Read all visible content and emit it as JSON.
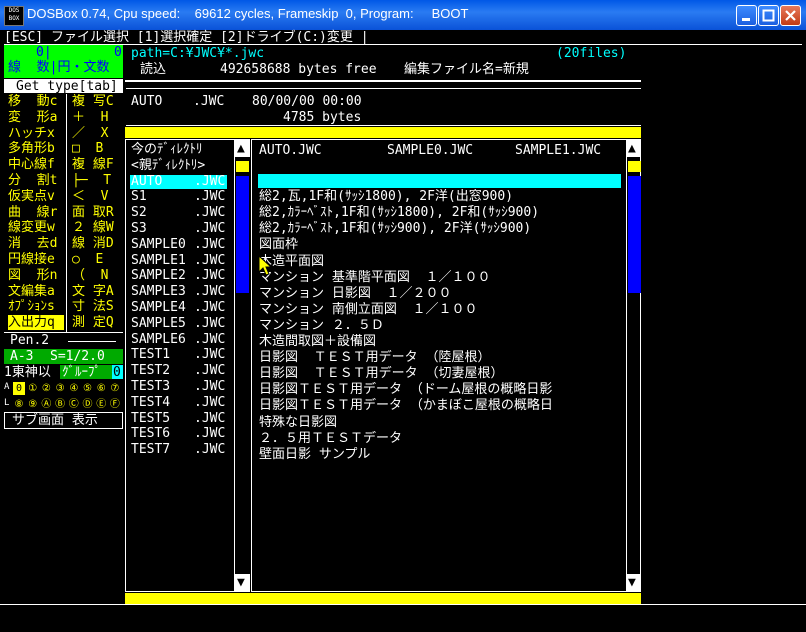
{
  "window": {
    "title": "DOSBox 0.74, Cpu speed:    69612 cycles, Frameskip  0, Program:     BOOT",
    "icon_text": [
      "DOS",
      "BOX"
    ]
  },
  "topbar": {
    "text": "[ESC] ファイル選択 [1]選択確定 [2]ドライブ(C:)変更 |"
  },
  "left_panel": {
    "header_nums": {
      "a": "0|",
      "b": "0"
    },
    "header_mode": "線  数|円・文数",
    "get_type": "Get type[tab]",
    "tools": [
      [
        "移  動c",
        "複 写C"
      ],
      [
        "変  形a",
        "＋  H"
      ],
      [
        "ハッチx",
        "／  X"
      ],
      [
        "多角形b",
        "□  B"
      ],
      [
        "中心線f",
        "複 線F"
      ],
      [
        "分  割t",
        "├─  T"
      ],
      [
        "仮実点v",
        "＜  V"
      ],
      [
        "曲  線r",
        "面 取R"
      ],
      [
        "線変更w",
        "２ 線W"
      ],
      [
        "消  去d",
        "線 消D"
      ],
      [
        "円線接e",
        "○  E"
      ],
      [
        "図  形n",
        "（  N"
      ],
      [
        "文編集a",
        "文 字A"
      ],
      [
        "ｵﾌﾟｼｮﾝs",
        "寸 法S"
      ],
      [
        "入出力q",
        "測 定Q"
      ]
    ],
    "pen": "Pen.2",
    "scale_a": "A-3",
    "scale_s": "S=1/2.0",
    "layer_label": "1東神以",
    "group_label": "ｸﾞﾙｰﾌﾟ",
    "group_val": "0",
    "row_a_prefix": "A",
    "row_l_prefix": "L",
    "row_a": [
      "0",
      "①",
      "②",
      "③",
      "④",
      "⑤",
      "⑥",
      "⑦"
    ],
    "row_l": [
      "⑧",
      "⑨",
      "Ⓐ",
      "Ⓑ",
      "Ⓒ",
      "Ⓓ",
      "Ⓔ",
      "Ⓕ"
    ],
    "sub_screen": "サブ画面 表示"
  },
  "file_header": {
    "path": "path=C:¥JWC¥*.jwc",
    "count": "(20files)",
    "read_label": "読込",
    "free": "492658688 bytes free",
    "mode": "編集ファイル名=新規"
  },
  "info_box": {
    "name": "AUTO",
    "ext": ".JWC",
    "datetime": "80/00/00 00:00",
    "size": "4785 bytes"
  },
  "dir_list": {
    "items": [
      {
        "name": "今のﾃﾞｨﾚｸﾄﾘ",
        "ext": ""
      },
      {
        "name": "<親ﾃﾞｨﾚｸﾄﾘ>",
        "ext": ""
      },
      {
        "name": "AUTO",
        "ext": ".JWC",
        "selected": true
      },
      {
        "name": "S1",
        "ext": ".JWC"
      },
      {
        "name": "S2",
        "ext": ".JWC"
      },
      {
        "name": "S3",
        "ext": ".JWC"
      },
      {
        "name": "SAMPLE0",
        "ext": ".JWC"
      },
      {
        "name": "SAMPLE1",
        "ext": ".JWC"
      },
      {
        "name": "SAMPLE2",
        "ext": ".JWC"
      },
      {
        "name": "SAMPLE3",
        "ext": ".JWC"
      },
      {
        "name": "SAMPLE4",
        "ext": ".JWC"
      },
      {
        "name": "SAMPLE5",
        "ext": ".JWC"
      },
      {
        "name": "SAMPLE6",
        "ext": ".JWC"
      },
      {
        "name": "TEST1",
        "ext": ".JWC"
      },
      {
        "name": "TEST2",
        "ext": ".JWC"
      },
      {
        "name": "TEST3",
        "ext": ".JWC"
      },
      {
        "name": "TEST4",
        "ext": ".JWC"
      },
      {
        "name": "TEST5",
        "ext": ".JWC"
      },
      {
        "name": "TEST6",
        "ext": ".JWC"
      },
      {
        "name": "TEST7",
        "ext": ".JWC"
      }
    ]
  },
  "desc_list": {
    "columns": [
      "AUTO.JWC",
      "SAMPLE0.JWC",
      "SAMPLE1.JWC"
    ],
    "lines": [
      "",
      "総2,瓦,1F和(ｻｯｼ1800), 2F洋(出窓900)",
      "総2,ｶﾗｰﾍﾞｽﾄ,1F和(ｻｯｼ1800), 2F和(ｻｯｼ900)",
      "総2,ｶﾗｰﾍﾞｽﾄ,1F和(ｻｯｼ900), 2F洋(ｻｯｼ900)",
      "図面枠",
      "木造平面図",
      "マンション 基準階平面図  １／１００",
      "マンション 日影図  １／２００",
      "マンション 南側立面図  １／１００",
      "マンション ２．５Ｄ",
      "木造間取図＋設備図",
      "日影図  ＴＥＳＴ用データ （陸屋根）",
      "日影図  ＴＥＳＴ用データ （切妻屋根）",
      "日影図ＴＥＳＴ用データ （ドーム屋根の概略日影",
      "日影図ＴＥＳＴ用データ （かまぼこ屋根の概略日",
      "特殊な日影図",
      "２．５用ＴＥＳＴデータ",
      "壁面日影 サンプル"
    ]
  },
  "scrollbar": {
    "up": "▲",
    "down": "▼"
  }
}
